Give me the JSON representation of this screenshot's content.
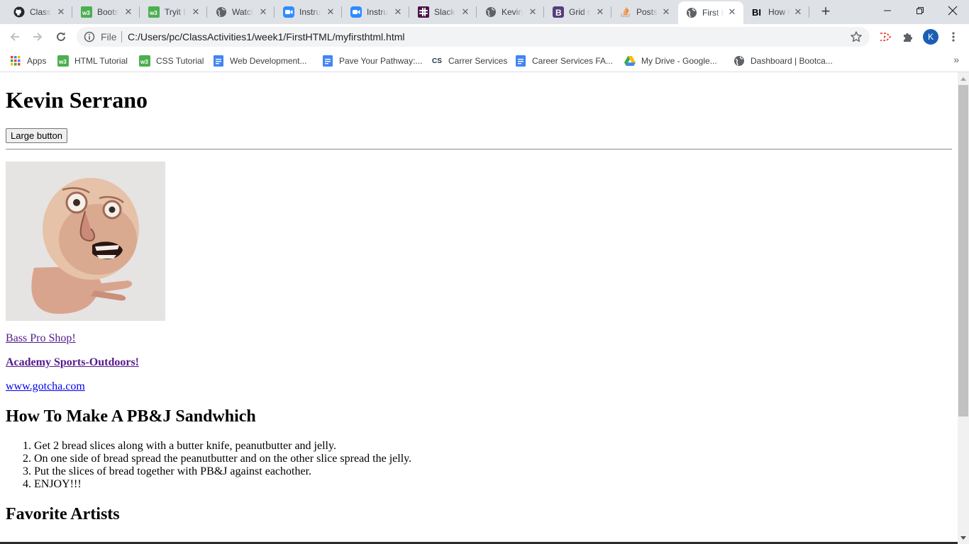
{
  "tabs": [
    {
      "title": "ClassA",
      "icon": "github-icon"
    },
    {
      "title": "Boots",
      "icon": "w3schools-icon"
    },
    {
      "title": "Tryit E",
      "icon": "w3schools-icon"
    },
    {
      "title": "Watch",
      "icon": "globe-icon"
    },
    {
      "title": "Instru",
      "icon": "zoom-icon"
    },
    {
      "title": "Instru",
      "icon": "zoom-icon"
    },
    {
      "title": "Slack",
      "icon": "slack-icon"
    },
    {
      "title": "Kevin",
      "icon": "globe-icon"
    },
    {
      "title": "Grid s",
      "icon": "bootstrap-icon"
    },
    {
      "title": "Posts",
      "icon": "stackoverflow-icon"
    },
    {
      "title": "First H",
      "icon": "globe-icon",
      "active": true
    },
    {
      "title": "How t",
      "icon": "bi-icon"
    }
  ],
  "address_bar": {
    "scheme_label": "File",
    "url": "C:/Users/pc/ClassActivities1/week1/FirstHTML/myfirsthtml.html"
  },
  "profile": {
    "initial": "K",
    "color": "#1a5fb4"
  },
  "bookmarks": [
    {
      "label": "Apps",
      "icon": "apps-grid-icon"
    },
    {
      "label": "HTML Tutorial",
      "icon": "w3schools-icon"
    },
    {
      "label": "CSS Tutorial",
      "icon": "w3schools-icon"
    },
    {
      "label": "Web Development...",
      "icon": "google-docs-icon"
    },
    {
      "label": "Pave Your Pathway:...",
      "icon": "google-docs-icon"
    },
    {
      "label": "Carrer Services",
      "icon": "cs-icon",
      "icon_text": "CS"
    },
    {
      "label": "Career Services FA...",
      "icon": "google-docs-icon"
    },
    {
      "label": "My Drive - Google...",
      "icon": "google-drive-icon"
    },
    {
      "label": "Dashboard | Bootca...",
      "icon": "globe-icon"
    }
  ],
  "page": {
    "heading": "Kevin Serrano",
    "button_label": "Large button",
    "links": {
      "bass_pro": "Bass Pro Shop!",
      "academy": "Academy Sports-Outdoors!",
      "gotcha": "www.gotcha.com"
    },
    "pbj_heading": "How To Make A PB&J Sandwhich",
    "steps": [
      "Get 2 bread slices along with a butter knife, peanutbutter and jelly.",
      "On one side of bread spread the peanutbutter and on the other slice spread the jelly.",
      "Put the slices of bread together with PB&J against eachother.",
      "ENJOY!!!"
    ],
    "artists_heading": "Favorite Artists"
  },
  "colors": {
    "tabbar_bg": "#dee1e6",
    "visited_link": "#551a8b",
    "unvisited_link": "#0000ee"
  }
}
